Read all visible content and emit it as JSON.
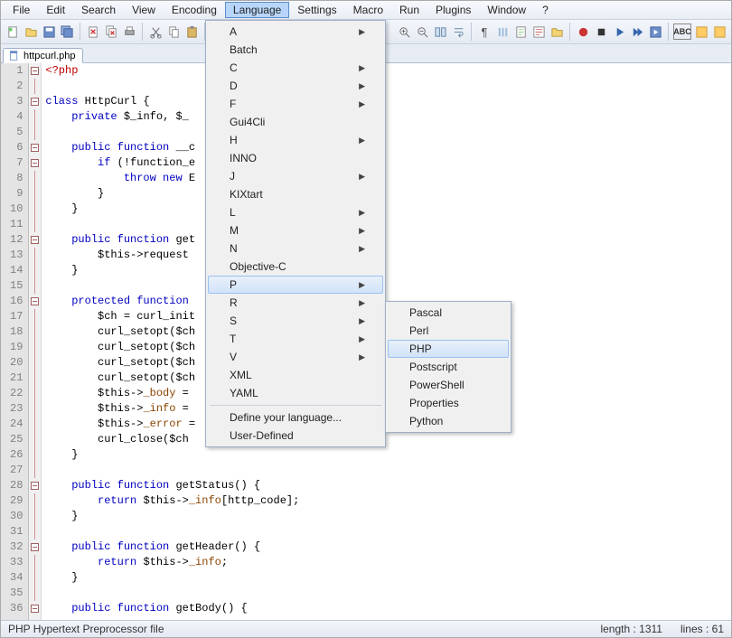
{
  "menubar": [
    "File",
    "Edit",
    "Search",
    "View",
    "Encoding",
    "Language",
    "Settings",
    "Macro",
    "Run",
    "Plugins",
    "Window",
    "?"
  ],
  "menubar_active_index": 5,
  "tab": {
    "label": "httpcurl.php"
  },
  "dropdown": {
    "items": [
      {
        "label": "A",
        "arrow": true
      },
      {
        "label": "Batch",
        "arrow": false
      },
      {
        "label": "C",
        "arrow": true
      },
      {
        "label": "D",
        "arrow": true
      },
      {
        "label": "F",
        "arrow": true
      },
      {
        "label": "Gui4Cli",
        "arrow": false
      },
      {
        "label": "H",
        "arrow": true
      },
      {
        "label": "INNO",
        "arrow": false
      },
      {
        "label": "J",
        "arrow": true
      },
      {
        "label": "KIXtart",
        "arrow": false
      },
      {
        "label": "L",
        "arrow": true
      },
      {
        "label": "M",
        "arrow": true
      },
      {
        "label": "N",
        "arrow": true
      },
      {
        "label": "Objective-C",
        "arrow": false
      },
      {
        "label": "P",
        "arrow": true,
        "hover": true
      },
      {
        "label": "R",
        "arrow": true
      },
      {
        "label": "S",
        "arrow": true
      },
      {
        "label": "T",
        "arrow": true
      },
      {
        "label": "V",
        "arrow": true
      },
      {
        "label": "XML",
        "arrow": false
      },
      {
        "label": "YAML",
        "arrow": false
      }
    ],
    "footer": [
      "Define your language...",
      "User-Defined"
    ]
  },
  "submenu": {
    "items": [
      "Pascal",
      "Perl",
      "PHP",
      "Postscript",
      "PowerShell",
      "Properties",
      "Python"
    ],
    "hover_index": 2
  },
  "code": {
    "lines": [
      {
        "n": 1,
        "fold": "box",
        "html": "<span class='k-tag'>&lt;?php</span>"
      },
      {
        "n": 2,
        "fold": "line",
        "html": ""
      },
      {
        "n": 3,
        "fold": "box",
        "html": "<span class='k-kw'>class</span> <span class='k-ident'>HttpCurl</span> {"
      },
      {
        "n": 4,
        "fold": "line",
        "html": "    <span class='k-kw'>private</span> <span class='k-var'>$_info</span>, <span class='k-var'>$_</span>"
      },
      {
        "n": 5,
        "fold": "line",
        "html": ""
      },
      {
        "n": 6,
        "fold": "box",
        "html": "    <span class='k-kw'>public</span> <span class='k-kw'>function</span> <span class='k-ident'>__c</span>"
      },
      {
        "n": 7,
        "fold": "box",
        "html": "        <span class='k-kw'>if</span> (!<span class='k-ident'>function_e</span>"
      },
      {
        "n": 8,
        "fold": "line",
        "html": "            <span class='k-kw'>throw new</span> <span class='k-ident'>E</span>"
      },
      {
        "n": 9,
        "fold": "line",
        "html": "        }"
      },
      {
        "n": 10,
        "fold": "line",
        "html": "    }"
      },
      {
        "n": 11,
        "fold": "line",
        "html": ""
      },
      {
        "n": 12,
        "fold": "box",
        "html": "    <span class='k-kw'>public</span> <span class='k-kw'>function</span> <span class='k-ident'>get</span>"
      },
      {
        "n": 13,
        "fold": "line",
        "html": "        <span class='k-var'>$this</span>-&gt;<span class='k-ident'>request</span>"
      },
      {
        "n": 14,
        "fold": "line",
        "html": "    }"
      },
      {
        "n": 15,
        "fold": "line",
        "html": ""
      },
      {
        "n": 16,
        "fold": "box",
        "html": "    <span class='k-kw'>protected</span> <span class='k-kw'>function</span>"
      },
      {
        "n": 17,
        "fold": "line",
        "html": "        <span class='k-var'>$ch</span> = <span class='k-ident'>curl_init</span>"
      },
      {
        "n": 18,
        "fold": "line",
        "html": "        <span class='k-ident'>curl_setopt</span>(<span class='k-var'>$ch</span>"
      },
      {
        "n": 19,
        "fold": "line",
        "html": "        <span class='k-ident'>curl_setopt</span>(<span class='k-var'>$ch</span>"
      },
      {
        "n": 20,
        "fold": "line",
        "html": "        <span class='k-ident'>curl_setopt</span>(<span class='k-var'>$ch</span>"
      },
      {
        "n": 21,
        "fold": "line",
        "html": "        <span class='k-ident'>curl_setopt</span>(<span class='k-var'>$ch</span>"
      },
      {
        "n": 22,
        "fold": "line",
        "html": "        <span class='k-var'>$this</span>-&gt;<span class='k-brown'>_body</span> ="
      },
      {
        "n": 23,
        "fold": "line",
        "html": "        <span class='k-var'>$this</span>-&gt;<span class='k-brown'>_info</span> ="
      },
      {
        "n": 24,
        "fold": "line",
        "html": "        <span class='k-var'>$this</span>-&gt;<span class='k-brown'>_error</span> ="
      },
      {
        "n": 25,
        "fold": "line",
        "html": "        <span class='k-ident'>curl_close</span>(<span class='k-var'>$ch</span>"
      },
      {
        "n": 26,
        "fold": "line",
        "html": "    }"
      },
      {
        "n": 27,
        "fold": "line",
        "html": ""
      },
      {
        "n": 28,
        "fold": "box",
        "html": "    <span class='k-kw'>public</span> <span class='k-kw'>function</span> <span class='k-ident'>getStatus</span>() {"
      },
      {
        "n": 29,
        "fold": "line",
        "html": "        <span class='k-kw'>return</span> <span class='k-var'>$this</span>-&gt;<span class='k-brown'>_info</span>[<span class='k-ident'>http_code</span>];"
      },
      {
        "n": 30,
        "fold": "line",
        "html": "    }"
      },
      {
        "n": 31,
        "fold": "line",
        "html": ""
      },
      {
        "n": 32,
        "fold": "box",
        "html": "    <span class='k-kw'>public</span> <span class='k-kw'>function</span> <span class='k-ident'>getHeader</span>() {"
      },
      {
        "n": 33,
        "fold": "line",
        "html": "        <span class='k-kw'>return</span> <span class='k-var'>$this</span>-&gt;<span class='k-brown'>_info</span>;"
      },
      {
        "n": 34,
        "fold": "line",
        "html": "    }"
      },
      {
        "n": 35,
        "fold": "line",
        "html": ""
      },
      {
        "n": 36,
        "fold": "box",
        "html": "    <span class='k-kw'>public</span> <span class='k-kw'>function</span> <span class='k-ident'>getBody</span>() {"
      }
    ]
  },
  "status": {
    "left": "PHP Hypertext Preprocessor file",
    "length_label": "length : 1311",
    "lines_label": "lines : 61"
  }
}
